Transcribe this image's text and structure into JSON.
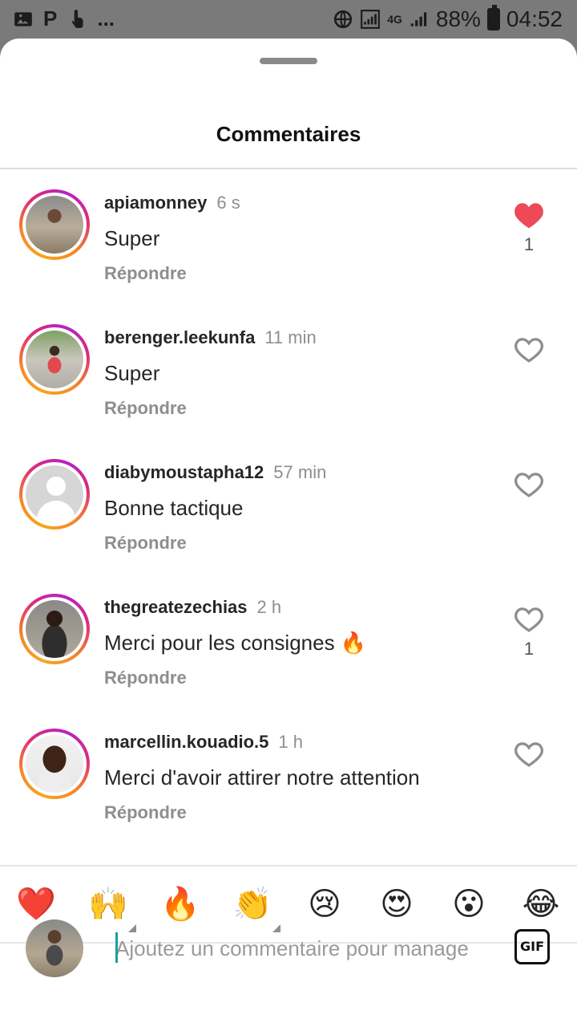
{
  "status_bar": {
    "left_icons": [
      "image-icon",
      "parking-icon",
      "touch-icon"
    ],
    "left_more": "...",
    "battery": "88%",
    "time": "04:52",
    "network": "4G"
  },
  "sheet": {
    "title": "Commentaires"
  },
  "comments": [
    {
      "user": "apiamonney",
      "time": "6 s",
      "text": "Super",
      "reply": "Répondre",
      "liked": true,
      "likes": "1"
    },
    {
      "user": "berenger.leekunfa",
      "time": "11 min",
      "text": "Super",
      "reply": "Répondre",
      "liked": false,
      "likes": ""
    },
    {
      "user": "diabymoustapha12",
      "time": "57 min",
      "text": "Bonne tactique",
      "reply": "Répondre",
      "liked": false,
      "likes": ""
    },
    {
      "user": "thegreatezechias",
      "time": "2 h",
      "text": "Merci pour les consignes 🔥",
      "reply": "Répondre",
      "liked": false,
      "likes": "1"
    },
    {
      "user": "marcellin.kouadio.5",
      "time": "1 h",
      "text": "Merci d'avoir attirer notre attention",
      "reply": "Répondre",
      "liked": false,
      "likes": ""
    }
  ],
  "emoji_bar": [
    "❤️",
    "🙌",
    "🔥",
    "👏",
    "😢",
    "😍",
    "😮",
    "😂"
  ],
  "composer": {
    "placeholder": "Ajoutez un commentaire pour manage",
    "gif_label": "GIF"
  },
  "colors": {
    "like_red": "#ed4956",
    "muted": "#8e8e8e",
    "text": "#262626"
  }
}
